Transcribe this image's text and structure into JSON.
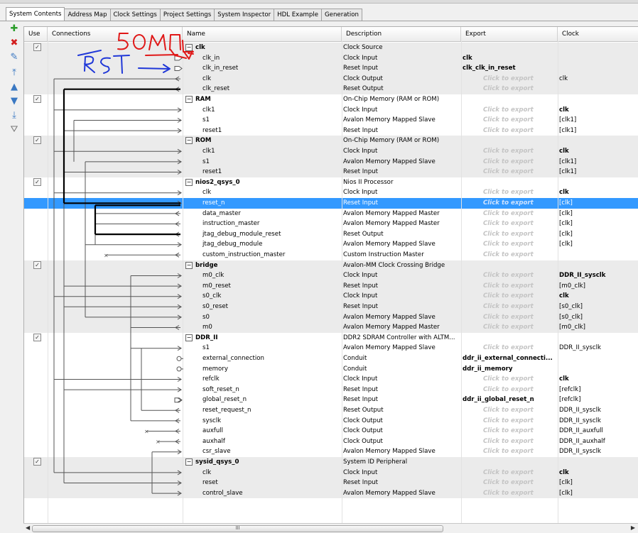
{
  "tabs": [
    "System Contents",
    "Address Map",
    "Clock Settings",
    "Project Settings",
    "System Inspector",
    "HDL Example",
    "Generation"
  ],
  "active_tab": "System Contents",
  "columns": {
    "use": "Use",
    "connections": "Connections",
    "name": "Name",
    "description": "Description",
    "export": "Export",
    "clock": "Clock"
  },
  "toolbar": [
    {
      "icon": "add-icon",
      "glyph": "✚",
      "color": "#2a9d2a"
    },
    {
      "icon": "remove-icon",
      "glyph": "✖",
      "color": "#d21f1f"
    },
    {
      "icon": "edit-icon",
      "glyph": "✎",
      "color": "#3a78c2"
    },
    {
      "icon": "move-top-icon",
      "glyph": "⤒",
      "color": "#3a78c2"
    },
    {
      "icon": "move-up-icon",
      "glyph": "▲",
      "color": "#3a78c2"
    },
    {
      "icon": "move-down-icon",
      "glyph": "▼",
      "color": "#3a78c2"
    },
    {
      "icon": "move-bottom-icon",
      "glyph": "⤓",
      "color": "#3a78c2"
    },
    {
      "icon": "filter-icon",
      "glyph": "⛛",
      "color": "#777777"
    }
  ],
  "placeholder_export": "Click to export",
  "annotations": {
    "top": "50МГц",
    "left": "RST"
  },
  "rows": [
    {
      "type": "comp",
      "use": true,
      "name": "clk",
      "desc": "Clock Source",
      "export": "",
      "clock": "",
      "shade": true
    },
    {
      "type": "if",
      "name": "clk_in",
      "desc": "Clock Input",
      "export": "clk",
      "exportBold": true,
      "clock": "",
      "shade": true
    },
    {
      "type": "if",
      "name": "clk_in_reset",
      "desc": "Reset Input",
      "export": "clk_clk_in_reset",
      "exportBold": true,
      "clock": "",
      "shade": true
    },
    {
      "type": "if",
      "name": "clk",
      "desc": "Clock Output",
      "export": "",
      "clock": "clk",
      "shade": true
    },
    {
      "type": "if",
      "name": "clk_reset",
      "desc": "Reset Output",
      "export": "",
      "clock": "",
      "shade": true
    },
    {
      "type": "comp",
      "use": true,
      "name": "RAM",
      "desc": "On-Chip Memory (RAM or ROM)",
      "export": "",
      "clock": "",
      "shade": false
    },
    {
      "type": "if",
      "name": "clk1",
      "desc": "Clock Input",
      "export": "",
      "clock": "clk",
      "clockBold": true,
      "shade": false
    },
    {
      "type": "if",
      "name": "s1",
      "desc": "Avalon Memory Mapped Slave",
      "export": "",
      "clock": "[clk1]",
      "shade": false
    },
    {
      "type": "if",
      "name": "reset1",
      "desc": "Reset Input",
      "export": "",
      "clock": "[clk1]",
      "shade": false
    },
    {
      "type": "comp",
      "use": true,
      "name": "ROM",
      "desc": "On-Chip Memory (RAM or ROM)",
      "export": "",
      "clock": "",
      "shade": true
    },
    {
      "type": "if",
      "name": "clk1",
      "desc": "Clock Input",
      "export": "",
      "clock": "clk",
      "clockBold": true,
      "shade": true
    },
    {
      "type": "if",
      "name": "s1",
      "desc": "Avalon Memory Mapped Slave",
      "export": "",
      "clock": "[clk1]",
      "shade": true
    },
    {
      "type": "if",
      "name": "reset1",
      "desc": "Reset Input",
      "export": "",
      "clock": "[clk1]",
      "shade": true
    },
    {
      "type": "comp",
      "use": true,
      "name": "nios2_qsys_0",
      "desc": "Nios II Processor",
      "export": "",
      "clock": "",
      "shade": false
    },
    {
      "type": "if",
      "name": "clk",
      "desc": "Clock Input",
      "export": "",
      "clock": "clk",
      "clockBold": true,
      "shade": false
    },
    {
      "type": "if",
      "name": "reset_n",
      "desc": "Reset Input",
      "export": "",
      "clock": "[clk]",
      "shade": false,
      "selected": true
    },
    {
      "type": "if",
      "name": "data_master",
      "desc": "Avalon Memory Mapped Master",
      "export": "",
      "clock": "[clk]",
      "shade": false
    },
    {
      "type": "if",
      "name": "instruction_master",
      "desc": "Avalon Memory Mapped Master",
      "export": "",
      "clock": "[clk]",
      "shade": false
    },
    {
      "type": "if",
      "name": "jtag_debug_module_reset",
      "desc": "Reset Output",
      "export": "",
      "clock": "[clk]",
      "shade": false
    },
    {
      "type": "if",
      "name": "jtag_debug_module",
      "desc": "Avalon Memory Mapped Slave",
      "export": "",
      "clock": "[clk]",
      "shade": false
    },
    {
      "type": "if",
      "name": "custom_instruction_master",
      "desc": "Custom Instruction Master",
      "export": "",
      "clock": "",
      "shade": false
    },
    {
      "type": "comp",
      "use": true,
      "name": "bridge",
      "desc": "Avalon-MM Clock Crossing Bridge",
      "export": "",
      "clock": "",
      "shade": true
    },
    {
      "type": "if",
      "name": "m0_clk",
      "desc": "Clock Input",
      "export": "",
      "clock": "DDR_II_sysclk",
      "clockBold": true,
      "shade": true
    },
    {
      "type": "if",
      "name": "m0_reset",
      "desc": "Reset Input",
      "export": "",
      "clock": "[m0_clk]",
      "shade": true
    },
    {
      "type": "if",
      "name": "s0_clk",
      "desc": "Clock Input",
      "export": "",
      "clock": "clk",
      "clockBold": true,
      "shade": true
    },
    {
      "type": "if",
      "name": "s0_reset",
      "desc": "Reset Input",
      "export": "",
      "clock": "[s0_clk]",
      "shade": true
    },
    {
      "type": "if",
      "name": "s0",
      "desc": "Avalon Memory Mapped Slave",
      "export": "",
      "clock": "[s0_clk]",
      "shade": true
    },
    {
      "type": "if",
      "name": "m0",
      "desc": "Avalon Memory Mapped Master",
      "export": "",
      "clock": "[m0_clk]",
      "shade": true
    },
    {
      "type": "comp",
      "use": true,
      "name": "DDR_II",
      "desc": "DDR2 SDRAM Controller with ALTM...",
      "export": "",
      "clock": "",
      "shade": false
    },
    {
      "type": "if",
      "name": "s1",
      "desc": "Avalon Memory Mapped Slave",
      "export": "",
      "clock": "DDR_II_sysclk",
      "shade": false
    },
    {
      "type": "if",
      "name": "external_connection",
      "desc": "Conduit",
      "export": "ddr_ii_external_connecti...",
      "exportBold": true,
      "clock": "",
      "shade": false
    },
    {
      "type": "if",
      "name": "memory",
      "desc": "Conduit",
      "export": "ddr_ii_memory",
      "exportBold": true,
      "clock": "",
      "shade": false
    },
    {
      "type": "if",
      "name": "refclk",
      "desc": "Clock Input",
      "export": "",
      "clock": "clk",
      "clockBold": true,
      "shade": false
    },
    {
      "type": "if",
      "name": "soft_reset_n",
      "desc": "Reset Input",
      "export": "",
      "clock": "[refclk]",
      "shade": false
    },
    {
      "type": "if",
      "name": "global_reset_n",
      "desc": "Reset Input",
      "export": "ddr_ii_global_reset_n",
      "exportBold": true,
      "clock": "[refclk]",
      "shade": false
    },
    {
      "type": "if",
      "name": "reset_request_n",
      "desc": "Reset Output",
      "export": "",
      "clock": "DDR_II_sysclk",
      "shade": false
    },
    {
      "type": "if",
      "name": "sysclk",
      "desc": "Clock Output",
      "export": "",
      "clock": "DDR_II_sysclk",
      "shade": false
    },
    {
      "type": "if",
      "name": "auxfull",
      "desc": "Clock Output",
      "export": "",
      "clock": "DDR_II_auxfull",
      "shade": false
    },
    {
      "type": "if",
      "name": "auxhalf",
      "desc": "Clock Output",
      "export": "",
      "clock": "DDR_II_auxhalf",
      "shade": false
    },
    {
      "type": "if",
      "name": "csr_slave",
      "desc": "Avalon Memory Mapped Slave",
      "export": "",
      "clock": "DDR_II_sysclk",
      "shade": false
    },
    {
      "type": "comp",
      "use": true,
      "name": "sysid_qsys_0",
      "desc": "System ID Peripheral",
      "export": "",
      "clock": "",
      "shade": true
    },
    {
      "type": "if",
      "name": "clk",
      "desc": "Clock Input",
      "export": "",
      "clock": "clk",
      "clockBold": true,
      "shade": true
    },
    {
      "type": "if",
      "name": "reset",
      "desc": "Reset Input",
      "export": "",
      "clock": "[clk]",
      "shade": true
    },
    {
      "type": "if",
      "name": "control_slave",
      "desc": "Avalon Memory Mapped Slave",
      "export": "",
      "clock": "[clk]",
      "shade": true
    }
  ],
  "scrollbar": {
    "thumb_label": "III"
  }
}
